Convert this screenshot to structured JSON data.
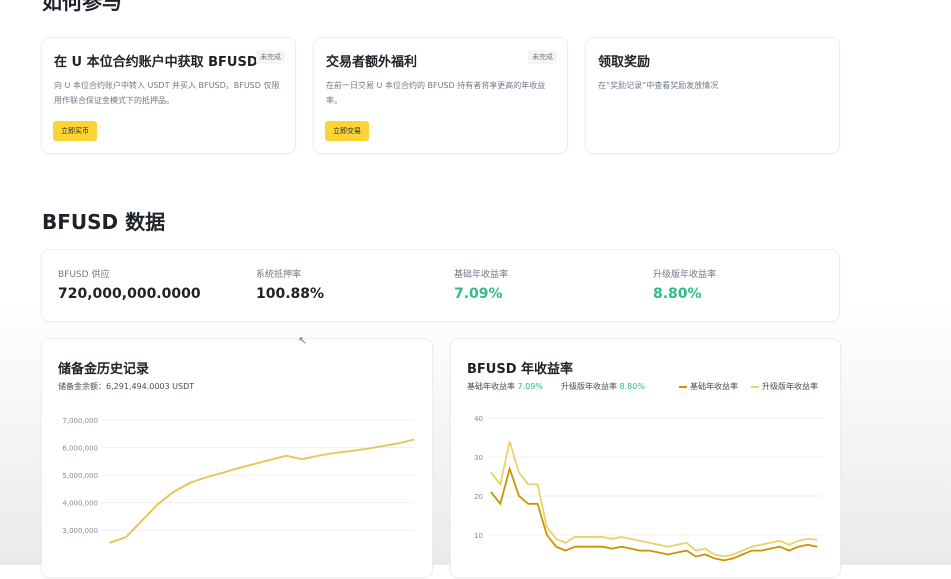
{
  "section1": {
    "title": "如何参与"
  },
  "tasks": [
    {
      "title": "在 U 本位合约账户中获取 BFUSD",
      "badge": "未完成",
      "desc": "向 U 本位合约账户中转入 USDT 并买入 BFUSD。BFUSD 仅限用作联合保证金模式下的抵押品。",
      "button": "立即买币"
    },
    {
      "title": "交易者额外福利",
      "badge": "未完成",
      "desc": "在前一日交易 U 本位合约的 BFUSD 持有者将享更高的年收益率。",
      "button": "立即交易"
    },
    {
      "title": "领取奖励",
      "badge": "",
      "desc": "在“奖励记录”中查看奖励发放情况",
      "button": ""
    }
  ],
  "section2": {
    "title": "BFUSD 数据"
  },
  "stats": [
    {
      "label": "BFUSD 供应",
      "value": "720,000,000.0000"
    },
    {
      "label": "系统抵押率",
      "value": "100.88%"
    },
    {
      "label": "基础年收益率",
      "value": "7.09%"
    },
    {
      "label": "升级版年收益率",
      "value": "8.80%"
    }
  ],
  "colors": {
    "accent": "#fcd535",
    "green": "#2ebd85",
    "base_line": "#c99400",
    "upgraded_line": "#e8d36a",
    "reserve_line": "#e7c75a"
  },
  "reserve_chart": {
    "title": "储备金历史记录",
    "subtitle_label": "储备金余额：",
    "subtitle_value": "6,291,494.0003 USDT"
  },
  "yield_chart": {
    "title": "BFUSD 年收益率",
    "legend_base_label": "基础年收益率",
    "legend_base_value": "7.09%",
    "legend_up_label": "升级版年收益率",
    "legend_up_value": "8.80%",
    "series_base_name": "基础年收益率",
    "series_up_name": "升级版年收益率"
  },
  "chart_data": [
    {
      "type": "line",
      "title": "储备金历史记录",
      "ylim": [
        2500000,
        7000000
      ],
      "yticks": [
        "7,000,000",
        "6,000,000",
        "5,000,000",
        "4,000,000",
        "3,000,000"
      ],
      "ytick_values": [
        7000000,
        6000000,
        5000000,
        4000000,
        3000000
      ],
      "x": [
        0,
        1,
        2,
        3,
        4,
        5,
        6,
        7,
        8,
        9,
        10,
        11,
        12,
        13,
        14,
        15,
        16,
        17,
        18,
        19
      ],
      "values": [
        2550000,
        2750000,
        3350000,
        3950000,
        4400000,
        4720000,
        4920000,
        5080000,
        5250000,
        5400000,
        5550000,
        5700000,
        5580000,
        5700000,
        5800000,
        5870000,
        5950000,
        6050000,
        6150000,
        6290000
      ],
      "grid": true
    },
    {
      "type": "line",
      "title": "BFUSD 年收益率",
      "ylim": [
        0,
        40
      ],
      "yticks": [
        "40",
        "30",
        "20",
        "10"
      ],
      "ytick_values": [
        40,
        30,
        20,
        10
      ],
      "x": [
        0,
        1,
        2,
        3,
        4,
        5,
        6,
        7,
        8,
        9,
        10,
        11,
        12,
        13,
        14,
        15,
        16,
        17,
        18,
        19,
        20,
        21,
        22,
        23,
        24,
        25,
        26,
        27,
        28,
        29,
        30,
        31,
        32,
        33,
        34,
        35
      ],
      "series": [
        {
          "name": "基础年收益率",
          "values": [
            21,
            18,
            27,
            20,
            18,
            18,
            10,
            7,
            6,
            7,
            7,
            7,
            7,
            6.5,
            7,
            6.5,
            6,
            6,
            5.5,
            5,
            5.5,
            6,
            4.5,
            5,
            4,
            3.5,
            4,
            5,
            6,
            6,
            6.5,
            7,
            6,
            7,
            7.5,
            7
          ]
        },
        {
          "name": "升级版年收益率",
          "values": [
            26,
            23,
            34,
            26,
            23,
            23,
            12,
            9,
            8,
            9.5,
            9.5,
            9.5,
            9.5,
            9,
            9.5,
            9,
            8.5,
            8,
            7.5,
            7,
            7.5,
            8,
            6,
            6.5,
            5,
            4.5,
            5,
            6,
            7,
            7.5,
            8,
            8.5,
            7.5,
            8.5,
            9,
            8.8
          ]
        }
      ],
      "legend": "top-right",
      "grid": true
    }
  ]
}
